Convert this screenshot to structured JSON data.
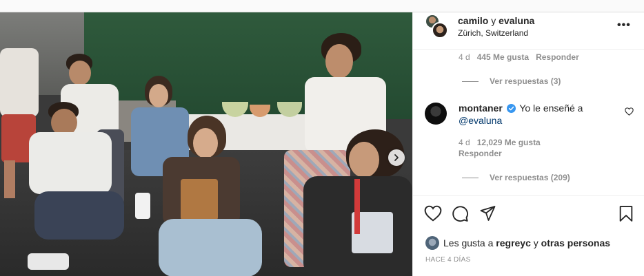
{
  "post": {
    "header": {
      "author_1": "camilo",
      "conjunction": "y",
      "author_2": "evaluna",
      "location": "Zürich, Switzerland"
    },
    "comment_1_meta": {
      "time": "4 d",
      "likes": "445 Me gusta",
      "reply": "Responder"
    },
    "comment_1_replies": "Ver respuestas (3)",
    "comment_2": {
      "username": "montaner",
      "text": "Yo le enseñé a",
      "mention": "@evaluna",
      "time": "4 d",
      "likes": "12,029 Me gusta",
      "reply": "Responder",
      "replies": "Ver respuestas (209)"
    },
    "likes_summary": {
      "prefix": "Les gusta a",
      "user": "regreyc",
      "conjunction": "y",
      "others": "otras personas"
    },
    "timestamp": "HACE 4 DÍAS"
  },
  "colors": {
    "verified": "#3897f0",
    "link": "#00376b",
    "muted": "#8e8e8e"
  }
}
